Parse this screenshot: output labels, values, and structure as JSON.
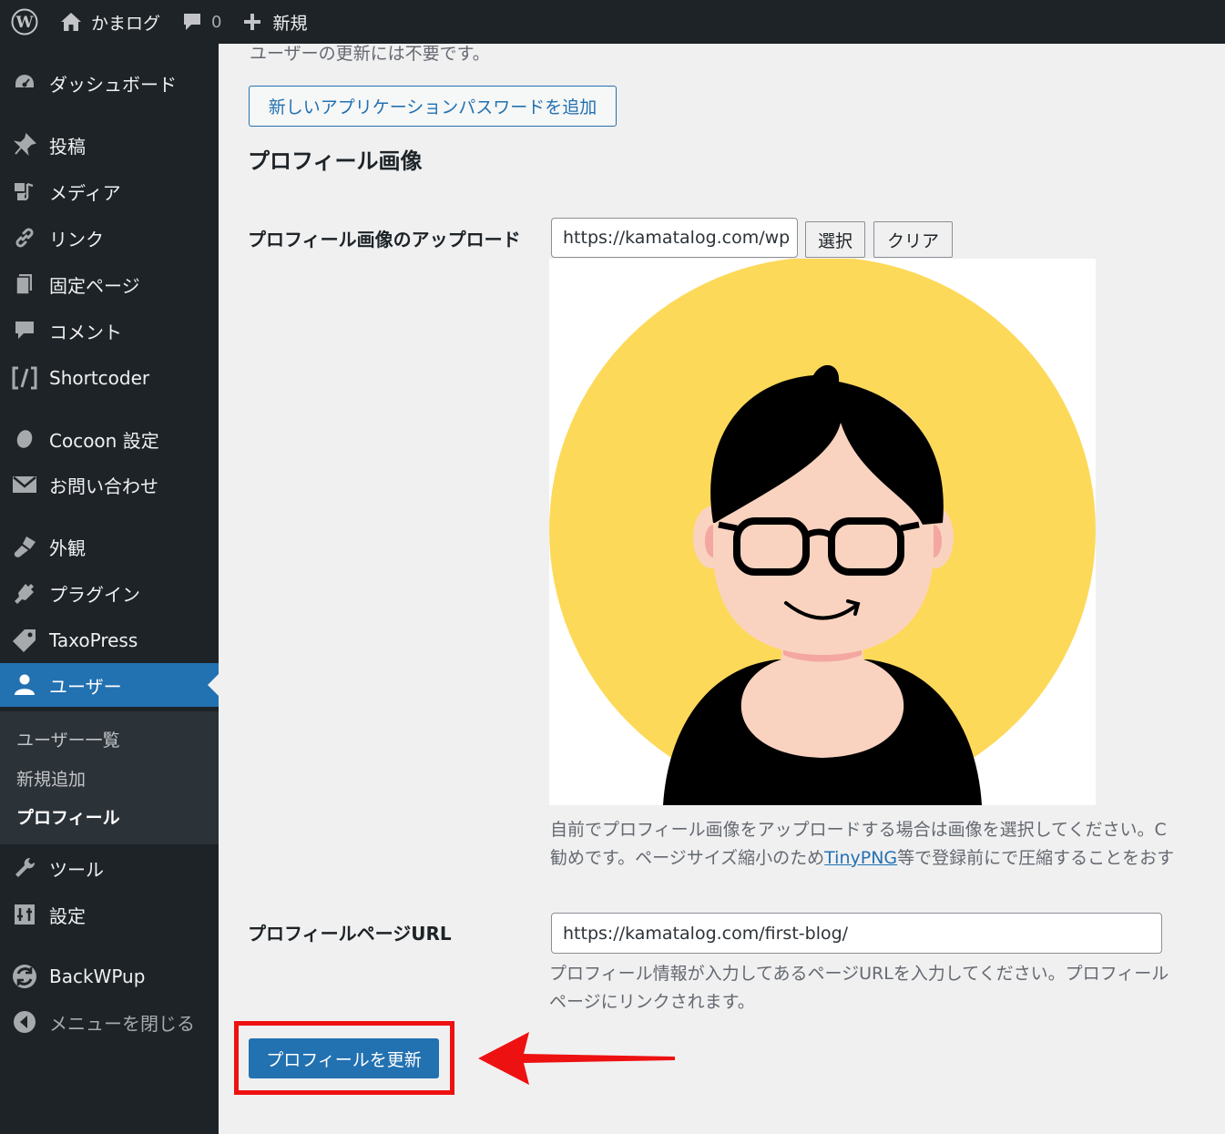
{
  "adminbar": {
    "site_name": "かまログ",
    "comment_count": "0",
    "new_label": "新規"
  },
  "sidebar": {
    "items": [
      {
        "label": "ダッシュボード",
        "icon": "dashboard-icon"
      },
      {
        "label": "投稿",
        "icon": "pushpin-icon"
      },
      {
        "label": "メディア",
        "icon": "media-icon"
      },
      {
        "label": "リンク",
        "icon": "link-icon"
      },
      {
        "label": "固定ページ",
        "icon": "page-icon"
      },
      {
        "label": "コメント",
        "icon": "comment-icon"
      },
      {
        "label": "Shortcoder",
        "icon": "shortcode-icon"
      },
      {
        "label": "Cocoon 設定",
        "icon": "cocoon-icon"
      },
      {
        "label": "お問い合わせ",
        "icon": "mail-icon"
      },
      {
        "label": "外観",
        "icon": "brush-icon"
      },
      {
        "label": "プラグイン",
        "icon": "plugin-icon"
      },
      {
        "label": "TaxoPress",
        "icon": "tag-icon"
      },
      {
        "label": "ユーザー",
        "icon": "user-icon"
      },
      {
        "label": "ツール",
        "icon": "wrench-icon"
      },
      {
        "label": "設定",
        "icon": "settings-icon"
      },
      {
        "label": "BackWPup",
        "icon": "backwpup-icon"
      },
      {
        "label": "メニューを閉じる",
        "icon": "collapse-icon"
      }
    ],
    "submenu": [
      "ユーザー一覧",
      "新規追加",
      "プロフィール"
    ]
  },
  "content": {
    "app_password_note": "ユーザーの更新には不要です。",
    "add_app_password_button": "新しいアプリケーションパスワードを追加",
    "profile_image_heading": "プロフィール画像",
    "upload_label": "プロフィール画像のアップロード",
    "upload_url_value": "https://kamatalog.com/wp",
    "select_button": "選択",
    "clear_button": "クリア",
    "image_desc_line1": "自前でプロフィール画像をアップロードする場合は画像を選択してください。C",
    "image_desc_line2_before": "勧めです。ページサイズ縮小のため",
    "image_desc_link": "TinyPNG",
    "image_desc_line2_after": "等で登録前にで圧縮することをおす",
    "profile_url_label": "プロフィールページURL",
    "profile_url_value": "https://kamatalog.com/first-blog/",
    "url_desc_line1": "プロフィール情報が入力してあるページURLを入力してください。プロフィール",
    "url_desc_line2": "ページにリンクされます。",
    "update_button": "プロフィールを更新"
  },
  "colors": {
    "admin_dark": "#1d2327",
    "accent_blue": "#2271b1",
    "highlight_red": "#ee1111",
    "avatar_yellow": "#fdd95a",
    "skin": "#f9d3bf"
  }
}
